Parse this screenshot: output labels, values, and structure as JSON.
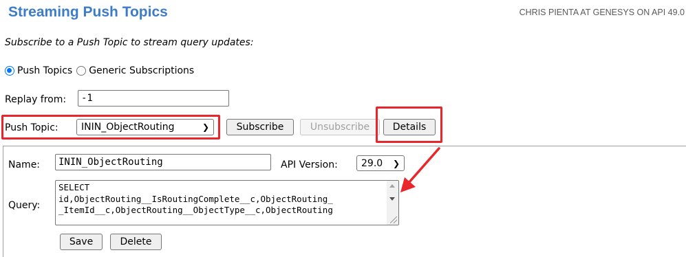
{
  "header": {
    "title": "Streaming Push Topics",
    "user_info": "CHRIS PIENTA AT GENESYS ON API 49.0"
  },
  "subtitle": "Subscribe to a Push Topic to stream query updates:",
  "subscription_type": {
    "options": [
      "Push Topics",
      "Generic Subscriptions"
    ],
    "selected": "Push Topics"
  },
  "replay": {
    "label": "Replay from:",
    "value": "-1"
  },
  "push_topic": {
    "label": "Push Topic:",
    "selected": "ININ_ObjectRouting"
  },
  "actions": {
    "subscribe_label": "Subscribe",
    "unsubscribe_label": "Unsubscribe",
    "details_label": "Details"
  },
  "details": {
    "name_label": "Name:",
    "name_value": "ININ_ObjectRouting",
    "api_version_label": "API Version:",
    "api_version_value": "29.0",
    "query_label": "Query:",
    "query_lines": [
      "SELECT",
      "id,ObjectRouting__IsRoutingComplete__c,ObjectRouting_",
      "_ItemId__c,ObjectRouting__ObjectType__c,ObjectRouting"
    ],
    "save_label": "Save",
    "delete_label": "Delete"
  },
  "colors": {
    "title": "#3d7cc9",
    "highlight": "#e8262c",
    "radio_accent": "#0075ff"
  }
}
